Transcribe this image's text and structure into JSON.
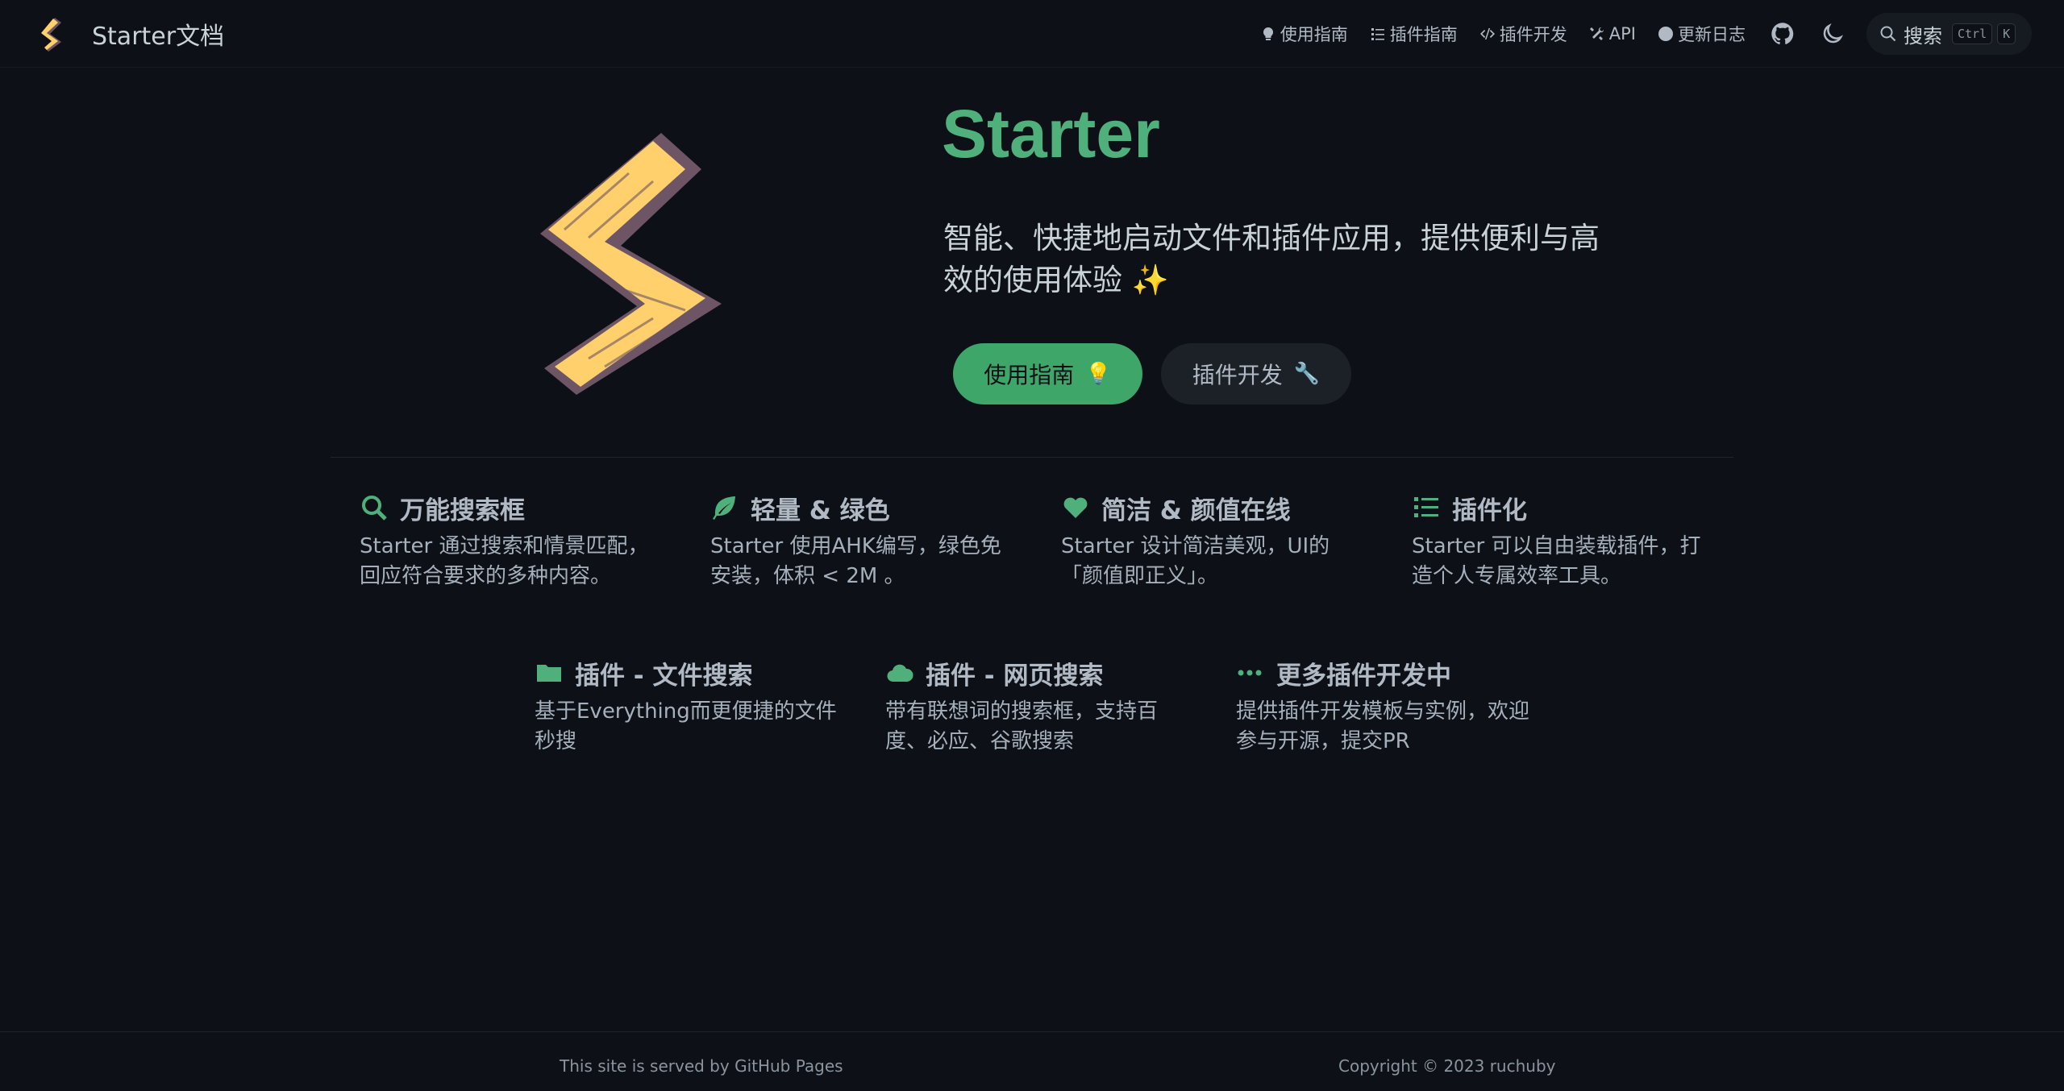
{
  "nav": {
    "brand_title": "Starter文档",
    "links": [
      {
        "label": "使用指南",
        "icon": "lightbulb-icon"
      },
      {
        "label": "插件指南",
        "icon": "list-icon"
      },
      {
        "label": "插件开发",
        "icon": "code-icon"
      },
      {
        "label": "API",
        "icon": "tools-icon"
      },
      {
        "label": "更新日志",
        "icon": "clock-icon"
      }
    ],
    "github_icon": "github-icon",
    "theme_icon": "moon-icon",
    "search": {
      "label": "搜索",
      "kbd1": "Ctrl",
      "kbd2": "K"
    }
  },
  "hero": {
    "title": "Starter",
    "tagline": "智能、快捷地启动文件和插件应用，提供便利与高效的使用体验 ✨",
    "primary_button": "使用指南",
    "primary_emoji": "💡",
    "secondary_button": "插件开发",
    "secondary_emoji": "🔧"
  },
  "features": [
    {
      "icon": "search-icon",
      "title": "万能搜索框",
      "desc": "Starter 通过搜索和情景匹配，回应符合要求的多种内容。"
    },
    {
      "icon": "leaf-icon",
      "title": "轻量 & 绿色",
      "desc": "Starter 使用AHK编写，绿色免安装，体积 < 2M 。"
    },
    {
      "icon": "heart-icon",
      "title": "简洁 & 颜值在线",
      "desc": "Starter 设计简洁美观，UI的「颜值即正义」。"
    },
    {
      "icon": "list-icon",
      "title": "插件化",
      "desc": "Starter 可以自由装载插件，打造个人专属效率工具。"
    },
    {
      "icon": "folder-icon",
      "title": "插件 - 文件搜索",
      "desc": "基于Everything而更便捷的文件秒搜"
    },
    {
      "icon": "cloud-icon",
      "title": "插件 - 网页搜索",
      "desc": "带有联想词的搜索框，支持百度、必应、谷歌搜索"
    },
    {
      "icon": "ellipsis-icon",
      "title": "更多插件开发中",
      "desc": "提供插件开发模板与实例，欢迎参与开源，提交PR"
    }
  ],
  "footer": {
    "left": "This site is served by GitHub Pages",
    "right": "Copyright © 2023 ruchuby"
  },
  "colors": {
    "accent": "#4fb07b",
    "background": "#0d1117",
    "logo_yellow": "#ffd06b",
    "logo_shadow": "#6e5566"
  }
}
